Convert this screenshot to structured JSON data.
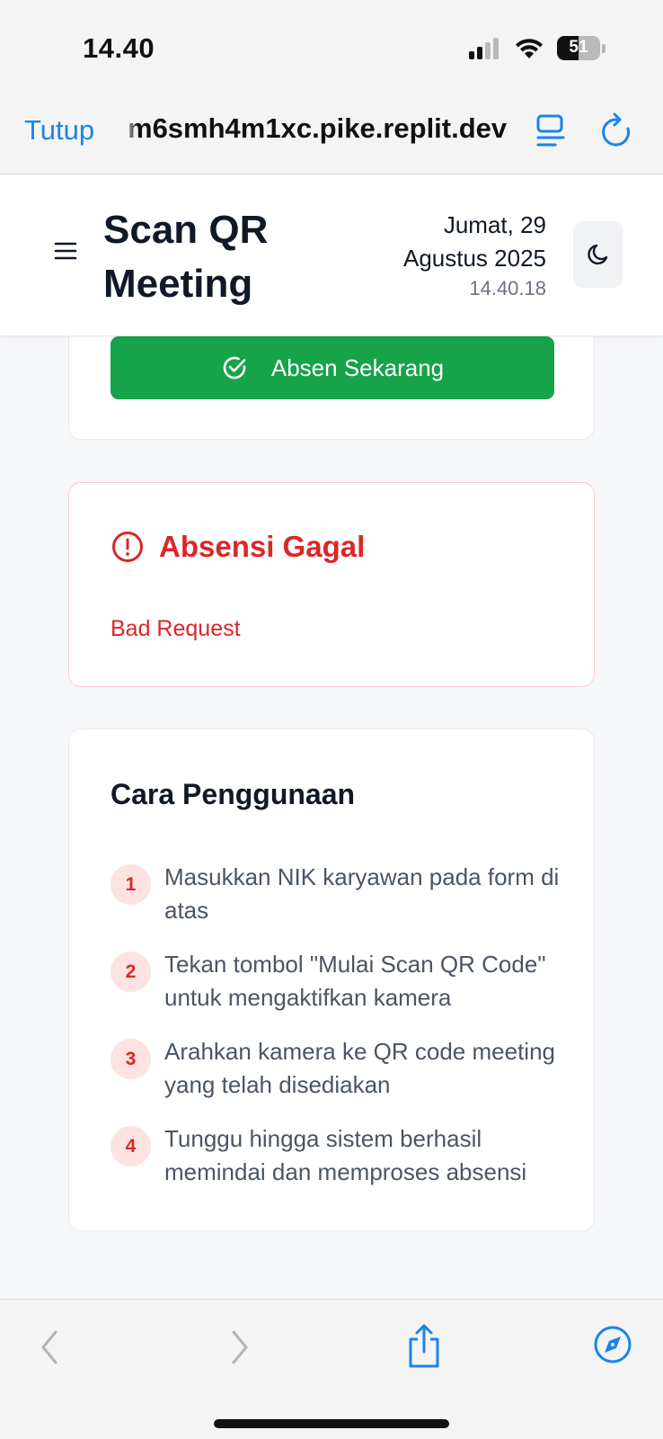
{
  "status_bar": {
    "time": "14.40",
    "battery_level": "51",
    "battery_fraction": 0.51,
    "signal_icon": "cellular-signal-icon",
    "wifi_icon": "wifi-icon"
  },
  "browser": {
    "close_label": "Tutup",
    "url": "m6smh4m1xc.pike.replit.dev",
    "reader_icon": "reader-mode-icon",
    "reload_icon": "reload-icon",
    "accent_color": "#1a84e8"
  },
  "header": {
    "title": "Scan QR Meeting",
    "date_line1": "Jumat, 29",
    "date_line2": "Agustus 2025",
    "clock": "14.40.18",
    "menu_icon": "menu-icon",
    "theme_icon": "moon-icon"
  },
  "attendance": {
    "button_label": "Absen Sekarang",
    "button_icon": "check-circle-icon",
    "button_color": "#16a34a"
  },
  "error": {
    "title": "Absensi Gagal",
    "message": "Bad Request",
    "icon": "alert-circle-icon",
    "color": "#dc2626"
  },
  "help": {
    "title": "Cara Penggunaan",
    "steps": [
      {
        "number": "1",
        "text": "Masukkan NIK karyawan pada form di atas"
      },
      {
        "number": "2",
        "text": "Tekan tombol \"Mulai Scan QR Code\" untuk mengaktifkan kamera"
      },
      {
        "number": "3",
        "text": "Arahkan kamera ke QR code meeting yang telah disediakan"
      },
      {
        "number": "4",
        "text": "Tunggu hingga sistem berhasil memindai dan memproses absensi"
      }
    ]
  },
  "toolbar": {
    "back_icon": "chevron-left-icon",
    "forward_icon": "chevron-right-icon",
    "share_icon": "share-icon",
    "compass_icon": "compass-icon"
  }
}
